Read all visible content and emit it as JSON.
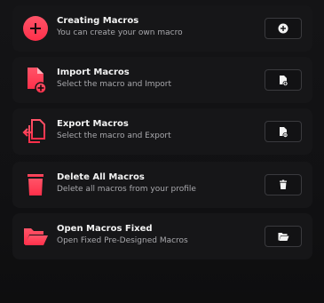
{
  "accent_color": "#ff3a55",
  "items": [
    {
      "title": "Creating Macros",
      "subtitle": "You can create your own macro",
      "icon": "plus-circle-icon",
      "action_icon": "plus-circle-icon"
    },
    {
      "title": "Import Macros",
      "subtitle": "Select the macro and Import",
      "icon": "file-import-icon",
      "action_icon": "file-plus-icon"
    },
    {
      "title": "Export Macros",
      "subtitle": "Select the macro and Export",
      "icon": "file-export-icon",
      "action_icon": "file-minus-icon"
    },
    {
      "title": "Delete All Macros",
      "subtitle": "Delete all macros from your profile",
      "icon": "trash-icon",
      "action_icon": "trash-icon"
    },
    {
      "title": "Open Macros Fixed",
      "subtitle": "Open Fixed Pre-Designed Macros",
      "icon": "folder-open-icon",
      "action_icon": "folder-open-icon"
    }
  ]
}
